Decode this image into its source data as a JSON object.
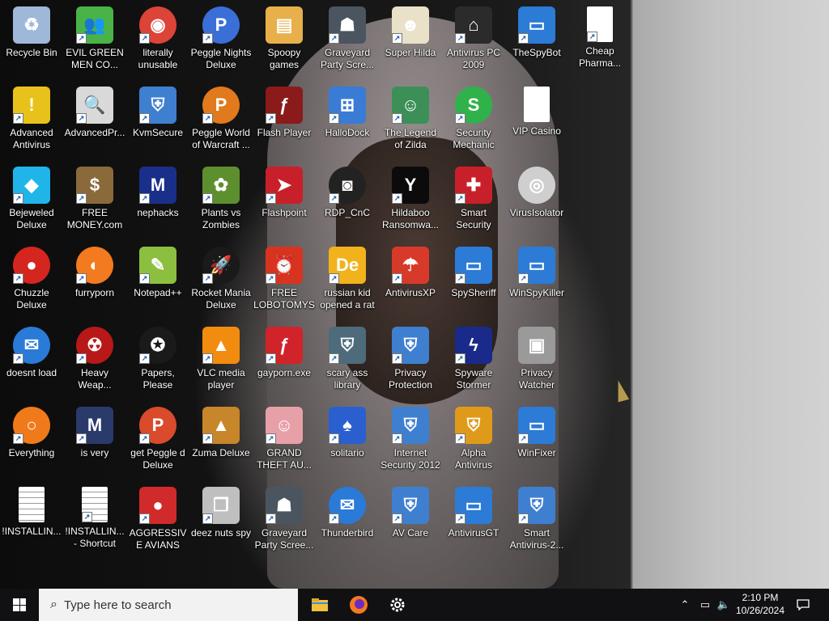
{
  "desktop": {
    "icons": [
      {
        "label": "Recycle Bin",
        "icon": "recycle-bin-icon",
        "color": "#9fb7d8",
        "glyph": "♻",
        "shortcut": false,
        "col": 0,
        "row": 0
      },
      {
        "label": "EVIL GREEN MEN CO...",
        "icon": "msn-men-icon",
        "color": "#49b347",
        "glyph": "👥",
        "shortcut": true,
        "col": 1,
        "row": 0
      },
      {
        "label": "literally unusable",
        "icon": "chrome-icon",
        "color": "#db4437",
        "glyph": "◉",
        "shortcut": true,
        "col": 2,
        "row": 0,
        "round": true
      },
      {
        "label": "Peggle Nights Deluxe",
        "icon": "peggle-nights-icon",
        "color": "#3b6fd8",
        "glyph": "P",
        "shortcut": true,
        "col": 3,
        "row": 0,
        "round": true
      },
      {
        "label": "Spoopy games",
        "icon": "folder-icon",
        "color": "#e8b04a",
        "glyph": "▤",
        "shortcut": false,
        "col": 4,
        "row": 0
      },
      {
        "label": "Graveyard Party Scre...",
        "icon": "graveyard-icon",
        "color": "#4a5560",
        "glyph": "☗",
        "shortcut": true,
        "col": 5,
        "row": 0
      },
      {
        "label": "Super Hilda",
        "icon": "super-hilda-icon",
        "color": "#e9e1c8",
        "glyph": "☻",
        "shortcut": true,
        "col": 6,
        "row": 0
      },
      {
        "label": "Antivirus PC 2009",
        "icon": "antivirus-pc-icon",
        "color": "#2b2b2b",
        "glyph": "⌂",
        "shortcut": true,
        "col": 7,
        "row": 0
      },
      {
        "label": "TheSpyBot",
        "icon": "window-app-icon",
        "color": "#2c7bd6",
        "glyph": "▭",
        "shortcut": true,
        "col": 8,
        "row": 0
      },
      {
        "label": "Cheap Pharma...",
        "icon": "blank-document-icon",
        "color": "#ffffff",
        "glyph": "",
        "shortcut": true,
        "col": 9,
        "row": 0,
        "doc": true
      },
      {
        "label": "Advanced Antivirus",
        "icon": "warning-shield-icon",
        "color": "#e8c21a",
        "glyph": "!",
        "shortcut": true,
        "col": 0,
        "row": 1
      },
      {
        "label": "AdvancedPr...",
        "icon": "magnifier-document-icon",
        "color": "#d9d9d9",
        "glyph": "🔍",
        "shortcut": true,
        "col": 1,
        "row": 1
      },
      {
        "label": "KvmSecure",
        "icon": "windows-shield-icon",
        "color": "#3f7fd0",
        "glyph": "⛨",
        "shortcut": true,
        "col": 2,
        "row": 1
      },
      {
        "label": "Peggle World of Warcraft ...",
        "icon": "peggle-wow-icon",
        "color": "#e07a1c",
        "glyph": "P",
        "shortcut": true,
        "col": 3,
        "row": 1,
        "round": true
      },
      {
        "label": "Flash Player",
        "icon": "flash-player-icon",
        "color": "#8b1a1a",
        "glyph": "ƒ",
        "shortcut": true,
        "col": 4,
        "row": 1
      },
      {
        "label": "HalloDock",
        "icon": "windows-logo-icon",
        "color": "#3a7bd5",
        "glyph": "⊞",
        "shortcut": true,
        "col": 5,
        "row": 1
      },
      {
        "label": "The Legend of Zilda",
        "icon": "zilda-icon",
        "color": "#3c8f57",
        "glyph": "☺",
        "shortcut": true,
        "col": 6,
        "row": 1
      },
      {
        "label": "Security Mechanic",
        "icon": "security-mechanic-icon",
        "color": "#2fb24a",
        "glyph": "S",
        "shortcut": true,
        "col": 7,
        "row": 1,
        "round": true
      },
      {
        "label": "VIP Casino",
        "icon": "blank-document-icon",
        "color": "#ffffff",
        "glyph": "",
        "shortcut": false,
        "col": 8,
        "row": 1,
        "doc": true
      },
      {
        "label": "Bejeweled Deluxe",
        "icon": "gem-icon",
        "color": "#1fb5e8",
        "glyph": "◆",
        "shortcut": true,
        "col": 0,
        "row": 2
      },
      {
        "label": "FREE MONEY.com",
        "icon": "money-bag-icon",
        "color": "#8a6a3a",
        "glyph": "$",
        "shortcut": true,
        "col": 1,
        "row": 2
      },
      {
        "label": "nephacks",
        "icon": "mpi-icon",
        "color": "#1a2f8a",
        "glyph": "M",
        "shortcut": true,
        "col": 2,
        "row": 2
      },
      {
        "label": "Plants vs Zombies",
        "icon": "plants-zombies-icon",
        "color": "#5e8f2f",
        "glyph": "✿",
        "shortcut": true,
        "col": 3,
        "row": 2
      },
      {
        "label": "Flashpoint",
        "icon": "flashpoint-icon",
        "color": "#c8202a",
        "glyph": "➤",
        "shortcut": true,
        "col": 4,
        "row": 2
      },
      {
        "label": "RDP_CnC",
        "icon": "rdp-icon",
        "color": "#222222",
        "glyph": "◙",
        "shortcut": true,
        "col": 5,
        "row": 2,
        "round": true
      },
      {
        "label": "Hildaboo Ransomwa...",
        "icon": "yashma-icon",
        "color": "#0b0b0b",
        "glyph": "Y",
        "shortcut": true,
        "col": 6,
        "row": 2
      },
      {
        "label": "Smart Security",
        "icon": "swiss-shield-icon",
        "color": "#c8202a",
        "glyph": "✚",
        "shortcut": true,
        "col": 7,
        "row": 2
      },
      {
        "label": "VirusIsolator",
        "icon": "disc-icon",
        "color": "#cfcfcf",
        "glyph": "◎",
        "shortcut": false,
        "col": 8,
        "row": 2,
        "round": true
      },
      {
        "label": "Chuzzle Deluxe",
        "icon": "chuzzle-icon",
        "color": "#d4261f",
        "glyph": "●",
        "shortcut": true,
        "col": 0,
        "row": 3,
        "round": true
      },
      {
        "label": "furryporn",
        "icon": "firefox-icon",
        "color": "#f37a1f",
        "glyph": "◐",
        "shortcut": true,
        "col": 1,
        "row": 3,
        "round": true
      },
      {
        "label": "Notepad++",
        "icon": "notepadpp-icon",
        "color": "#8cbf3f",
        "glyph": "✎",
        "shortcut": true,
        "col": 2,
        "row": 3
      },
      {
        "label": "Rocket Mania Deluxe",
        "icon": "rocket-mania-icon",
        "color": "#1a1a1a",
        "glyph": "🚀",
        "shortcut": true,
        "col": 3,
        "row": 3,
        "round": true
      },
      {
        "label": "FREE LOBOTOMYS",
        "icon": "clock-icon",
        "color": "#d7341f",
        "glyph": "⏰",
        "shortcut": true,
        "col": 4,
        "row": 3
      },
      {
        "label": "russian kid opened a rat",
        "icon": "de-icon",
        "color": "#f2b21c",
        "glyph": "De",
        "shortcut": true,
        "col": 5,
        "row": 3
      },
      {
        "label": "AntivirusXP",
        "icon": "umbrella-icon",
        "color": "#d83a2a",
        "glyph": "☂",
        "shortcut": true,
        "col": 6,
        "row": 3
      },
      {
        "label": "SpySheriff",
        "icon": "window-app-icon",
        "color": "#2c7bd6",
        "glyph": "▭",
        "shortcut": true,
        "col": 7,
        "row": 3
      },
      {
        "label": "WinSpyKiller",
        "icon": "window-app-icon",
        "color": "#2c7bd6",
        "glyph": "▭",
        "shortcut": true,
        "col": 8,
        "row": 3
      },
      {
        "label": "doesnt load",
        "icon": "thunderbird-icon",
        "color": "#2a7ad8",
        "glyph": "✉",
        "shortcut": true,
        "col": 0,
        "row": 4,
        "round": true
      },
      {
        "label": "Heavy Weap...",
        "icon": "radiation-icon",
        "color": "#b81818",
        "glyph": "☢",
        "shortcut": true,
        "col": 1,
        "row": 4,
        "round": true
      },
      {
        "label": "Papers, Please",
        "icon": "papers-please-icon",
        "color": "#1a1a1a",
        "glyph": "✪",
        "shortcut": true,
        "col": 2,
        "row": 4,
        "round": true
      },
      {
        "label": "VLC media player",
        "icon": "vlc-cone-icon",
        "color": "#f28c0f",
        "glyph": "▲",
        "shortcut": true,
        "col": 3,
        "row": 4
      },
      {
        "label": "gayporn.exe",
        "icon": "flash-player-icon",
        "color": "#d0242a",
        "glyph": "ƒ",
        "shortcut": true,
        "col": 4,
        "row": 4
      },
      {
        "label": "scary ass library",
        "icon": "library-icon",
        "color": "#4d6b7a",
        "glyph": "⛨",
        "shortcut": true,
        "col": 5,
        "row": 4
      },
      {
        "label": "Privacy Protection",
        "icon": "windows-shield-icon",
        "color": "#3f7fd0",
        "glyph": "⛨",
        "shortcut": true,
        "col": 6,
        "row": 4
      },
      {
        "label": "Spyware Stormer",
        "icon": "lightning-icon",
        "color": "#1a2a8a",
        "glyph": "ϟ",
        "shortcut": true,
        "col": 7,
        "row": 4
      },
      {
        "label": "Privacy Watcher",
        "icon": "safe-icon",
        "color": "#9a9a9a",
        "glyph": "▣",
        "shortcut": false,
        "col": 8,
        "row": 4
      },
      {
        "label": "Everything",
        "icon": "everything-search-icon",
        "color": "#f07a1a",
        "glyph": "○",
        "shortcut": true,
        "col": 0,
        "row": 5,
        "round": true
      },
      {
        "label": "is very",
        "icon": "mpi-shield-icon",
        "color": "#2a3a6a",
        "glyph": "M",
        "shortcut": true,
        "col": 1,
        "row": 5
      },
      {
        "label": "get Peggle d Deluxe",
        "icon": "peggle-deluxe-icon",
        "color": "#d94b2a",
        "glyph": "P",
        "shortcut": true,
        "col": 2,
        "row": 5,
        "round": true
      },
      {
        "label": "Zuma Deluxe",
        "icon": "zuma-icon",
        "color": "#c7862a",
        "glyph": "▲",
        "shortcut": true,
        "col": 3,
        "row": 5
      },
      {
        "label": "GRAND THEFT AU...",
        "icon": "anime-girl-icon",
        "color": "#e8a0a8",
        "glyph": "☺",
        "shortcut": true,
        "col": 4,
        "row": 5
      },
      {
        "label": "solitario",
        "icon": "cards-icon",
        "color": "#2a5fd0",
        "glyph": "♠",
        "shortcut": true,
        "col": 5,
        "row": 5
      },
      {
        "label": "Internet Security 2012",
        "icon": "windows-shield-icon",
        "color": "#3f7fd0",
        "glyph": "⛨",
        "shortcut": true,
        "col": 6,
        "row": 5
      },
      {
        "label": "Alpha Antivirus",
        "icon": "alpha-shield-icon",
        "color": "#e09a1a",
        "glyph": "⛨",
        "shortcut": true,
        "col": 7,
        "row": 5
      },
      {
        "label": "WinFixer",
        "icon": "window-app-icon",
        "color": "#2c7bd6",
        "glyph": "▭",
        "shortcut": true,
        "col": 8,
        "row": 5
      },
      {
        "label": "!INSTALLIN...",
        "icon": "text-document-icon",
        "color": "#ffffff",
        "glyph": "",
        "shortcut": false,
        "col": 0,
        "row": 6,
        "doc": true,
        "lined": true
      },
      {
        "label": "!INSTALLIN... - Shortcut",
        "icon": "text-document-icon",
        "color": "#ffffff",
        "glyph": "",
        "shortcut": true,
        "col": 1,
        "row": 6,
        "doc": true,
        "lined": true
      },
      {
        "label": "AGGRESSIVE AVIANS",
        "icon": "angry-bird-icon",
        "color": "#d02a2a",
        "glyph": "●",
        "shortcut": true,
        "col": 2,
        "row": 6
      },
      {
        "label": "deez nuts spy",
        "icon": "copy-windows-icon",
        "color": "#bfbfbf",
        "glyph": "❐",
        "shortcut": true,
        "col": 3,
        "row": 6
      },
      {
        "label": "Graveyard Party Scree...",
        "icon": "graveyard-icon",
        "color": "#4a5560",
        "glyph": "☗",
        "shortcut": true,
        "col": 4,
        "row": 6
      },
      {
        "label": "Thunderbird",
        "icon": "thunderbird-icon",
        "color": "#2a7ad8",
        "glyph": "✉",
        "shortcut": true,
        "col": 5,
        "row": 6,
        "round": true
      },
      {
        "label": "AV Care",
        "icon": "windows-shield-icon",
        "color": "#3f7fd0",
        "glyph": "⛨",
        "shortcut": true,
        "col": 6,
        "row": 6
      },
      {
        "label": "AntivirusGT",
        "icon": "window-app-icon",
        "color": "#2c7bd6",
        "glyph": "▭",
        "shortcut": true,
        "col": 7,
        "row": 6
      },
      {
        "label": "Smart Antivirus-2...",
        "icon": "windows-shield-icon",
        "color": "#3f7fd0",
        "glyph": "⛨",
        "shortcut": true,
        "col": 8,
        "row": 6
      }
    ]
  },
  "taskbar": {
    "search_placeholder": "Type here to search",
    "pinned": [
      {
        "name": "file-explorer-icon",
        "color": "#f3c03b"
      },
      {
        "name": "firefox-icon",
        "color": "#f37a1f"
      },
      {
        "name": "settings-gear-icon",
        "color": "#ffffff"
      }
    ],
    "clock_time": "2:10 PM",
    "clock_date": "10/26/2024"
  }
}
